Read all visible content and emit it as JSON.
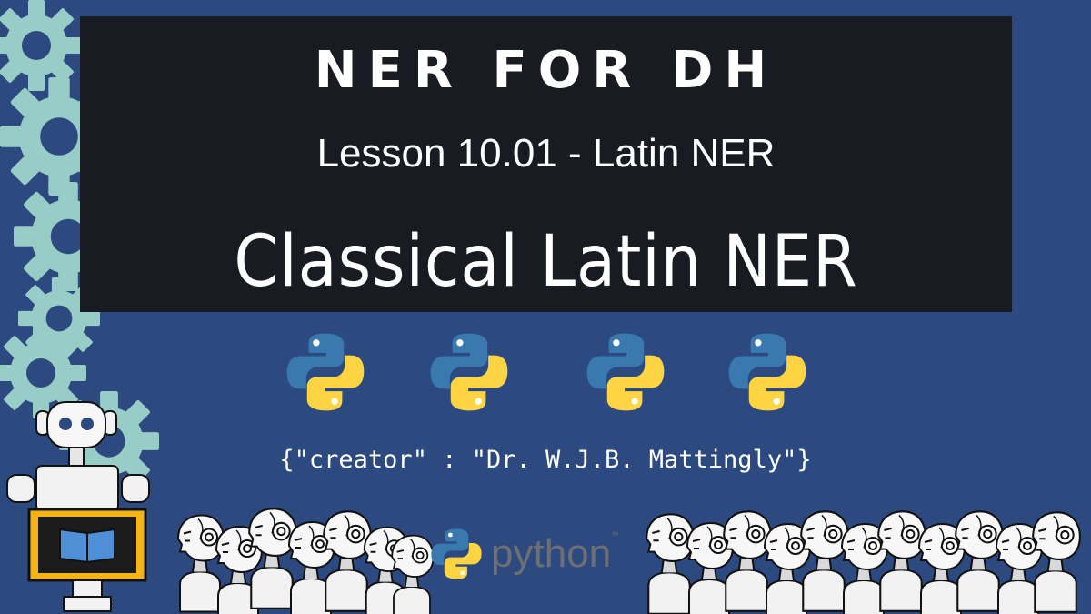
{
  "banner": {
    "series_title": "NER FOR DH",
    "lesson_line": "Lesson 10.01 - Latin NER",
    "lesson_title": "Classical Latin NER"
  },
  "creator_line": "{\"creator\" : \"Dr. W.J.B. Mattingly\"}",
  "brand": {
    "word": "python",
    "tm": "™"
  },
  "colors": {
    "background": "#2c4a80",
    "banner": "#191b22",
    "gear": "#98cdc7",
    "python_blue": "#3a78b0",
    "python_yellow": "#fdd443",
    "monitor_frame": "#f4b418"
  },
  "icons": [
    "gear-icon",
    "python-logo-icon",
    "robot-icon",
    "book-icon",
    "robot-head-icon"
  ]
}
